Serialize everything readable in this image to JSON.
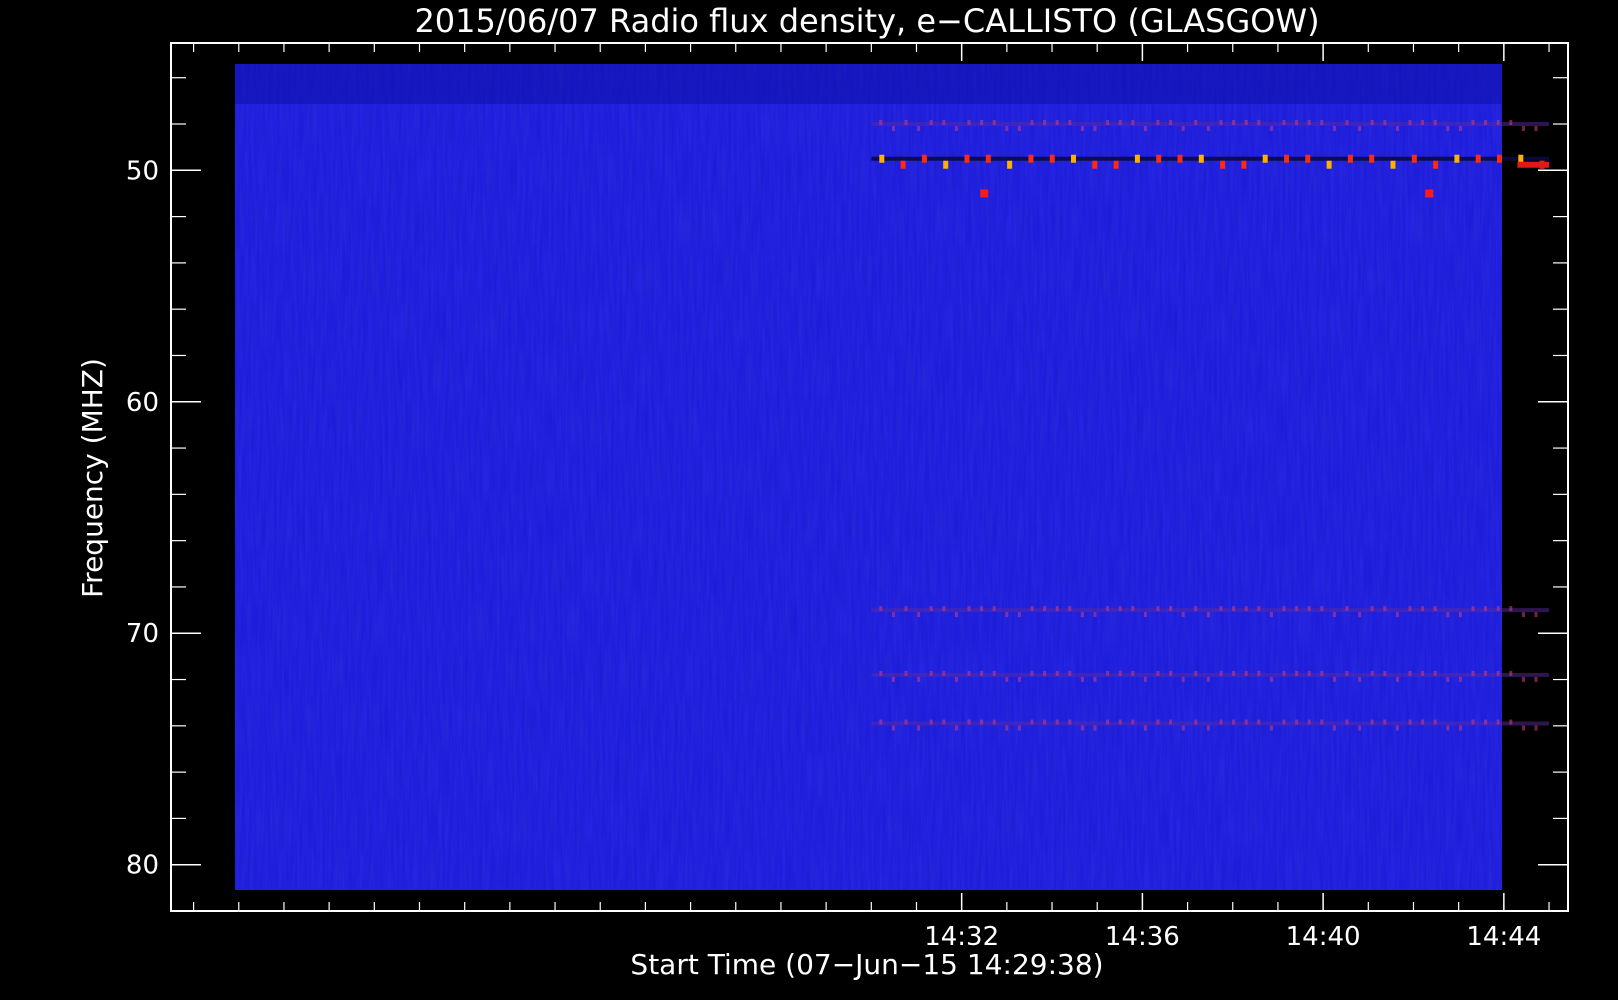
{
  "chart_data": {
    "type": "heatmap",
    "title": "2015/06/07  Radio flux density, e−CALLISTO (GLASGOW)",
    "xlabel": "Start Time (07−Jun−15 14:29:38)",
    "ylabel": "Frequency (MHZ)",
    "x_range_minutes": [
      14.5,
      45.42
    ],
    "y_range_mhz": [
      44.5,
      82
    ],
    "data_x_range_minutes": [
      30.0,
      45.0
    ],
    "data_y_range_mhz": [
      45.4,
      81.0
    ],
    "y_reversed": true,
    "x_ticks": [
      {
        "value": 32,
        "label": "14:32"
      },
      {
        "value": 36,
        "label": "14:36"
      },
      {
        "value": 40,
        "label": "14:40"
      },
      {
        "value": 44,
        "label": "14:44"
      }
    ],
    "y_ticks": [
      {
        "value": 50,
        "label": "50"
      },
      {
        "value": 60,
        "label": "60"
      },
      {
        "value": 70,
        "label": "70"
      },
      {
        "value": 80,
        "label": "80"
      }
    ],
    "x_minor_step_minutes": 1,
    "y_minor_step_mhz": 2,
    "colors": {
      "background": "#000000",
      "frame": "#ffffff",
      "heatmap_base": "#1a1ad8",
      "interference_peak": "#ff2020",
      "interference_hot": "#ffd000"
    },
    "interference_bands_mhz": [
      {
        "freq": 48.0,
        "intensity": 0.35
      },
      {
        "freq": 49.5,
        "intensity": 1.0
      },
      {
        "freq": 69.0,
        "intensity": 0.25
      },
      {
        "freq": 71.8,
        "intensity": 0.3
      },
      {
        "freq": 73.9,
        "intensity": 0.35
      }
    ],
    "isolated_spikes": [
      {
        "time": 32.5,
        "freq": 51.0
      },
      {
        "time": 42.35,
        "freq": 51.0
      }
    ]
  }
}
